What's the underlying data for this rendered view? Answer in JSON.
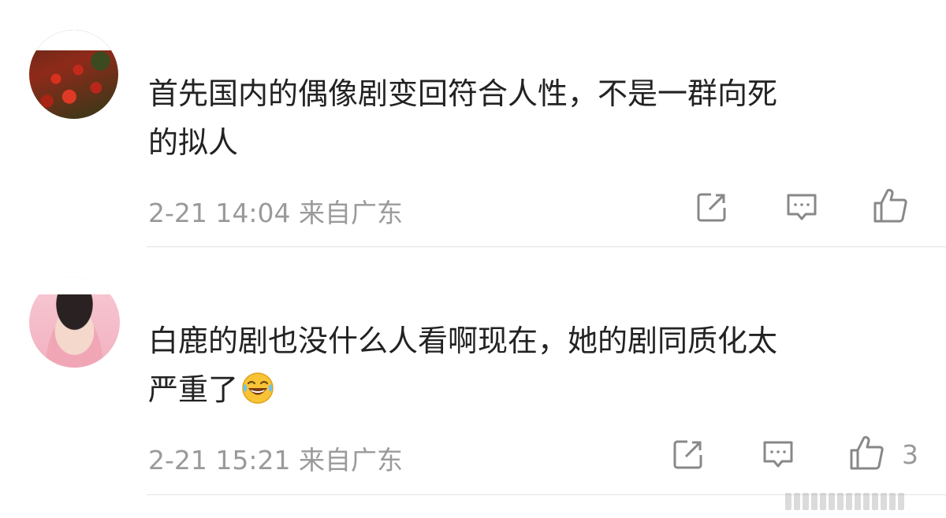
{
  "comments": [
    {
      "text_line1": "首先国内的偶像剧变回符合人性，不是一群向死",
      "text_line2": "的拟人",
      "time": "2-21 14:04",
      "location": "来自广东",
      "like_count": ""
    },
    {
      "text_line1": "白鹿的剧也没什么人看啊现在，她的剧同质化太",
      "text_line2": "严重了",
      "emoji": "laugh-cry-emoji",
      "time": "2-21 15:21",
      "location": "来自广东",
      "like_count": "3"
    }
  ],
  "icons": {
    "share": "share-icon",
    "comment": "comment-icon",
    "like": "thumbs-up-icon"
  },
  "colors": {
    "text": "#222222",
    "meta": "#9a9a9a",
    "icon": "#888888",
    "divider": "#e2e2e2"
  }
}
